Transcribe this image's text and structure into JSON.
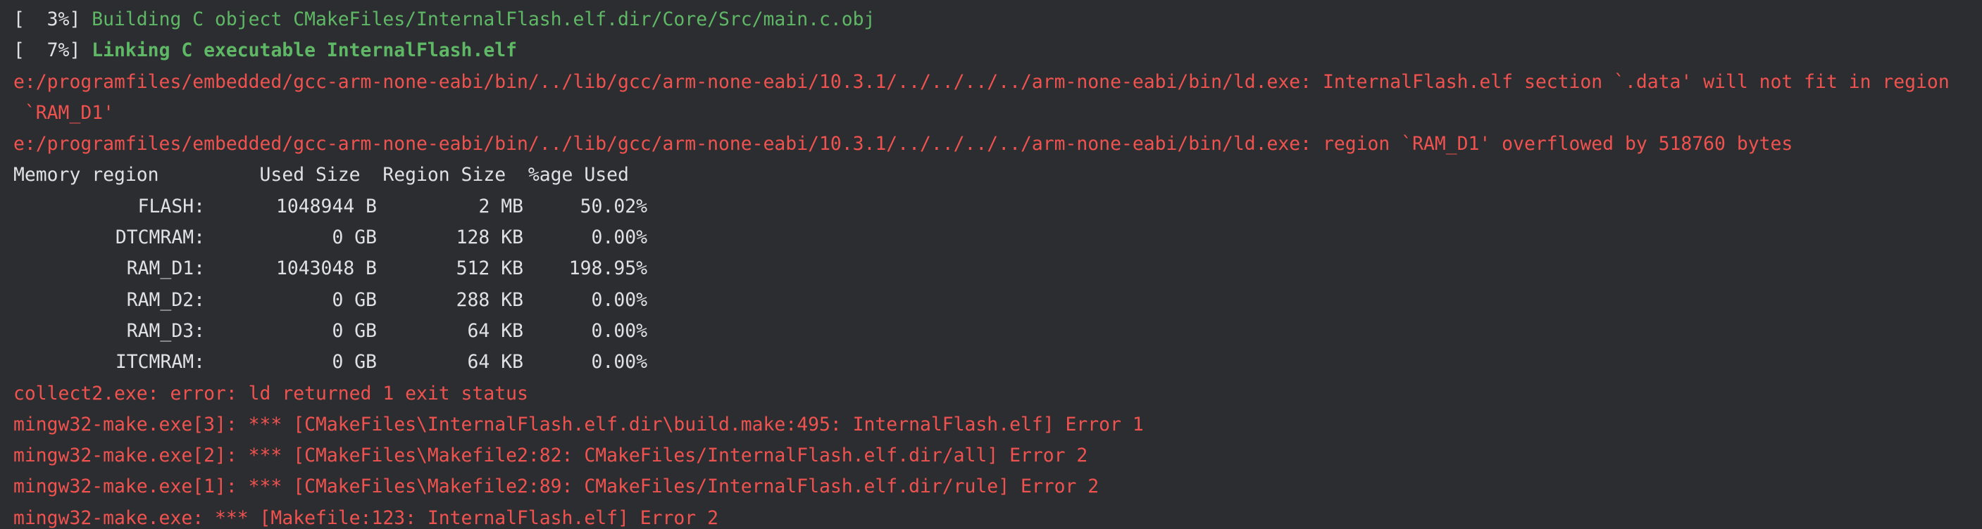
{
  "terminal": {
    "lines": [
      {
        "prefix": "[  3%] ",
        "text": "Building C object CMakeFiles/InternalFlash.elf.dir/Core/Src/main.c.obj"
      },
      {
        "prefix": "[  7%] ",
        "text": "Linking C executable InternalFlash.elf"
      },
      {
        "text": "e:/programfiles/embedded/gcc-arm-none-eabi/bin/../lib/gcc/arm-none-eabi/10.3.1/../../../../arm-none-eabi/bin/ld.exe: InternalFlash.elf section `.data' will not fit in region"
      },
      {
        "text": " `RAM_D1'"
      },
      {
        "text": "e:/programfiles/embedded/gcc-arm-none-eabi/bin/../lib/gcc/arm-none-eabi/10.3.1/../../../../arm-none-eabi/bin/ld.exe: region `RAM_D1' overflowed by 518760 bytes"
      }
    ],
    "memory_header": "Memory region         Used Size  Region Size  %age Used",
    "memory_rows": [
      {
        "name": "FLASH:",
        "used": "1048944 B",
        "size": "2 MB",
        "pct": "50.02%"
      },
      {
        "name": "DTCMRAM:",
        "used": "0 GB",
        "size": "128 KB",
        "pct": "0.00%"
      },
      {
        "name": "RAM_D1:",
        "used": "1043048 B",
        "size": "512 KB",
        "pct": "198.95%"
      },
      {
        "name": "RAM_D2:",
        "used": "0 GB",
        "size": "288 KB",
        "pct": "0.00%"
      },
      {
        "name": "RAM_D3:",
        "used": "0 GB",
        "size": "64 KB",
        "pct": "0.00%"
      },
      {
        "name": "ITCMRAM:",
        "used": "0 GB",
        "size": "64 KB",
        "pct": "0.00%"
      }
    ],
    "error_lines": [
      "collect2.exe: error: ld returned 1 exit status",
      "mingw32-make.exe[3]: *** [CMakeFiles\\InternalFlash.elf.dir\\build.make:495: InternalFlash.elf] Error 1",
      "mingw32-make.exe[2]: *** [CMakeFiles\\Makefile2:82: CMakeFiles/InternalFlash.elf.dir/all] Error 2",
      "mingw32-make.exe[1]: *** [CMakeFiles\\Makefile2:89: CMakeFiles/InternalFlash.elf.dir/rule] Error 2",
      "mingw32-make.exe: *** [Makefile:123: InternalFlash.elf] Error 2"
    ]
  },
  "colors": {
    "background": "#2b2d30",
    "text": "#dfe1e5",
    "green": "#5fb865",
    "red": "#f0524f"
  }
}
